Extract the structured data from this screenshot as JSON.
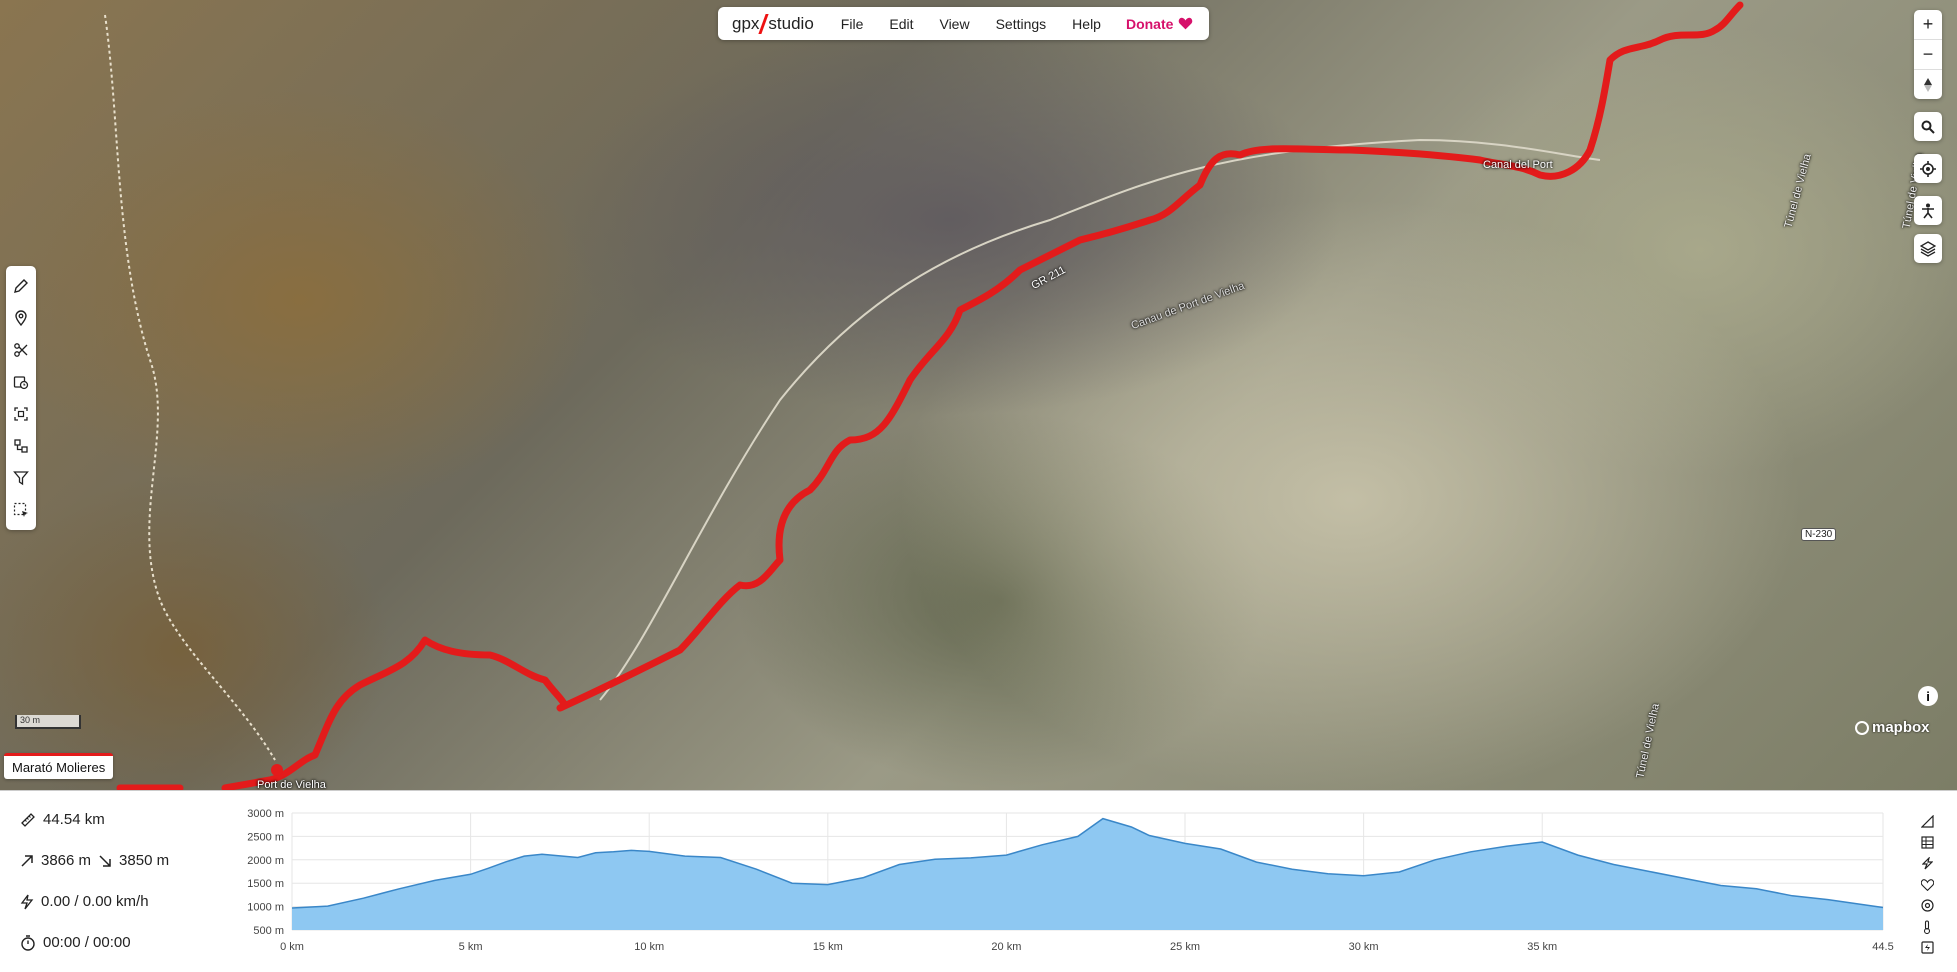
{
  "app": {
    "brand_left": "gpx",
    "brand_right": "studio",
    "menu": [
      "File",
      "Edit",
      "View",
      "Settings",
      "Help"
    ],
    "donate_label": "Donate"
  },
  "map": {
    "labels": {
      "canal_del_port": "Canal del Port",
      "gr211": "GR 211",
      "canau": "Canau de Port de Vielha",
      "tunel_right_top": "Túnel de Vielha",
      "tunel_right_mid": "Túnel de Vielha",
      "tunel_right_bottom": "Túnel de Vielha",
      "port_de_vielha": "Port de Vielha",
      "road": "N-230"
    },
    "scale_label": "30 m",
    "track_name": "Marató Molieres",
    "attribution": "mapbox",
    "track_color": "#e31b1b",
    "left_tools": [
      "pencil-icon",
      "map-pin-icon",
      "scissors-icon",
      "clock-calendar-icon",
      "select-frame-icon",
      "merge-icon",
      "filter-icon",
      "dashed-select-icon"
    ],
    "right_controls": [
      "zoom-in-icon",
      "zoom-out-icon",
      "compass-icon",
      "search-icon",
      "locate-icon",
      "street-view-person-icon",
      "layers-icon"
    ]
  },
  "stats": {
    "distance": "44.54 km",
    "elevation_up": "3866 m",
    "elevation_down": "3850 m",
    "speed": "0.00 / 0.00 km/h",
    "time": "00:00 / 00:00"
  },
  "profile_icons": [
    "slope-icon",
    "grid-icon",
    "lightning-icon",
    "heart-icon",
    "cadence-icon",
    "thermometer-icon",
    "power-icon"
  ],
  "chart_data": {
    "type": "area",
    "x_label_unit": "km",
    "y_ticks": [
      "3000 m",
      "2500 m",
      "2000 m",
      "1500 m",
      "1000 m",
      "500 m"
    ],
    "x_ticks": [
      "0 km",
      "5 km",
      "10 km",
      "15 km",
      "20 km",
      "25 km",
      "30 km",
      "35 km",
      "44.5"
    ],
    "xlim": [
      0,
      44.54
    ],
    "ylim": [
      500,
      3000
    ],
    "fill_color": "#8ec8f2",
    "line_color": "#3a87c8",
    "x": [
      0,
      1,
      2,
      3,
      4,
      5,
      5.5,
      6,
      6.5,
      7,
      8,
      8.5,
      9,
      9.5,
      10,
      11,
      12,
      13,
      14,
      15,
      16,
      17,
      18,
      19,
      20,
      21,
      22,
      22.7,
      23.5,
      24,
      25,
      26,
      27,
      28,
      29,
      30,
      31,
      32,
      33,
      34,
      35,
      36,
      37,
      38,
      39,
      40,
      41,
      42,
      43,
      44.54
    ],
    "y": [
      970,
      1010,
      1180,
      1380,
      1560,
      1690,
      1820,
      1960,
      2080,
      2120,
      2050,
      2150,
      2170,
      2200,
      2180,
      2080,
      2050,
      1800,
      1500,
      1470,
      1620,
      1900,
      2010,
      2040,
      2100,
      2320,
      2500,
      2880,
      2700,
      2520,
      2350,
      2230,
      1950,
      1800,
      1700,
      1660,
      1740,
      2000,
      2170,
      2290,
      2380,
      2100,
      1900,
      1750,
      1600,
      1450,
      1380,
      1230,
      1150,
      980
    ]
  }
}
